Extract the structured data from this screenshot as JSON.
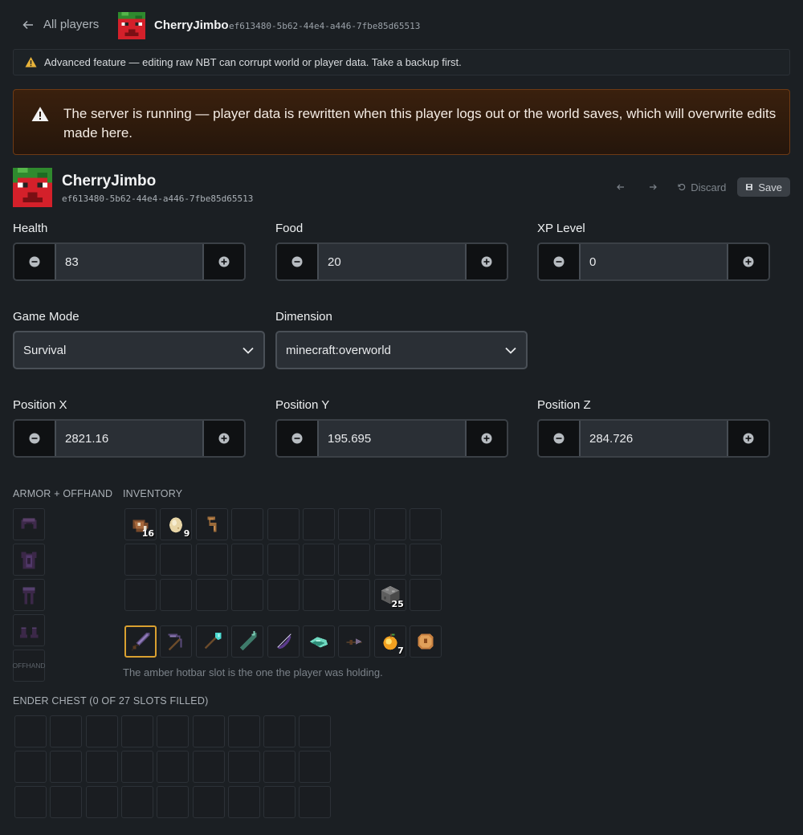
{
  "topbar": {
    "back_label": "All players",
    "player_name": "CherryJimbo",
    "player_uuid": "ef613480-5b62-44e4-a446-7fbe85d65513"
  },
  "advanced_notice": "Advanced feature — editing raw NBT can corrupt world or player data. Take a backup first.",
  "running_notice": "The server is running — player data is rewritten when this player logs out or the world saves, which will overwrite edits made here.",
  "player": {
    "name": "CherryJimbo",
    "uuid": "ef613480-5b62-44e4-a446-7fbe85d65513"
  },
  "actions": {
    "discard_label": "Discard",
    "save_label": "Save"
  },
  "fields": {
    "health": {
      "label": "Health",
      "value": "83"
    },
    "food": {
      "label": "Food",
      "value": "20"
    },
    "xp_level": {
      "label": "XP Level",
      "value": "0"
    },
    "game_mode": {
      "label": "Game Mode",
      "value": "Survival"
    },
    "dimension": {
      "label": "Dimension",
      "value": "minecraft:overworld"
    },
    "pos_x": {
      "label": "Position X",
      "value": "2821.16"
    },
    "pos_y": {
      "label": "Position Y",
      "value": "195.695"
    },
    "pos_z": {
      "label": "Position Z",
      "value": "284.726"
    }
  },
  "armor": {
    "title": "ARMOR + OFFHAND",
    "slots": [
      "netherite-helmet",
      "netherite-chestplate",
      "netherite-leggings",
      "netherite-boots"
    ],
    "offhand_label": "OFFHAND"
  },
  "inventory": {
    "title": "INVENTORY",
    "main_items": [
      {
        "icon": "cooked-beef-icon",
        "count": "16"
      },
      {
        "icon": "egg-icon",
        "count": "9"
      },
      {
        "icon": "lead-icon",
        "count": ""
      },
      {
        "icon": "cobblestone-icon",
        "count": "25"
      }
    ],
    "hotbar": [
      {
        "icon": "netherite-sword-icon",
        "count": ""
      },
      {
        "icon": "netherite-pickaxe-icon",
        "count": ""
      },
      {
        "icon": "diamond-shovel-icon",
        "count": ""
      },
      {
        "icon": "trident-icon",
        "count": ""
      },
      {
        "icon": "bow-icon",
        "count": ""
      },
      {
        "icon": "elytra-icon",
        "count": ""
      },
      {
        "icon": "crossbow-icon",
        "count": ""
      },
      {
        "icon": "golden-apple-icon",
        "count": "7"
      },
      {
        "icon": "cooked-porkchop-icon",
        "count": ""
      }
    ],
    "hint": "The amber hotbar slot is the one the player was holding."
  },
  "ender_chest": {
    "title": "ENDER CHEST (0 OF 27 SLOTS FILLED)"
  },
  "colors": {
    "accent_warning": "#d9a030",
    "running_border": "#6e3a14",
    "background": "#1b1f23"
  }
}
